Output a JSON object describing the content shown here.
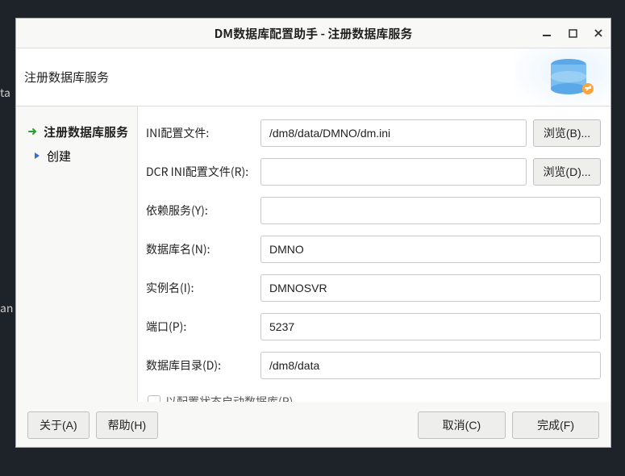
{
  "backdrop": {
    "text1": "ta",
    "text2": "an"
  },
  "window": {
    "title": "DM数据库配置助手 - 注册数据库服务"
  },
  "header": {
    "title": "注册数据库服务"
  },
  "sidebar": {
    "items": [
      {
        "label": "注册数据库服务",
        "active": true
      },
      {
        "label": "创建",
        "active": false
      }
    ]
  },
  "form": {
    "ini_label": "INI配置文件:",
    "ini_value": "/dm8/data/DMNO/dm.ini",
    "ini_browse": "浏览(B)...",
    "dcr_label": "DCR INI配置文件(R):",
    "dcr_value": "",
    "dcr_browse": "浏览(D)...",
    "dep_label": "依赖服务(Y):",
    "dep_value": "",
    "dbname_label": "数据库名(N):",
    "dbname_value": "DMNO",
    "inst_label": "实例名(I):",
    "inst_value": "DMNOSVR",
    "port_label": "端口(P):",
    "port_value": "5237",
    "dir_label": "数据库目录(D):",
    "dir_value": "/dm8/data",
    "chk_label": "以配置状态启动数据库(R)"
  },
  "footer": {
    "about": "关于(A)",
    "help": "帮助(H)",
    "cancel": "取消(C)",
    "finish": "完成(F)"
  }
}
